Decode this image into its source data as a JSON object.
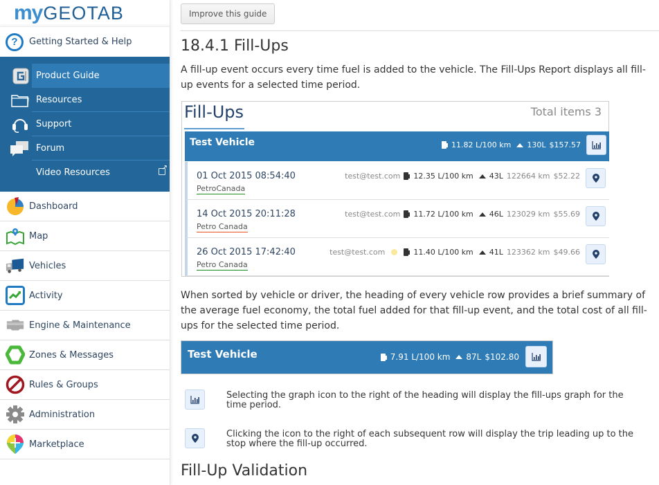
{
  "sidebar": {
    "logo": {
      "my": "my",
      "geotab": "GEOTAB"
    },
    "help": {
      "label": "Getting Started & Help",
      "icon": "question-circle-icon"
    },
    "help_items": [
      {
        "label": "Product Guide",
        "icon": "product-guide-icon",
        "active": true
      },
      {
        "label": "Resources",
        "icon": "folder-icon"
      },
      {
        "label": "Support",
        "icon": "headset-icon"
      },
      {
        "label": "Forum",
        "icon": "chat-bubbles-icon"
      },
      {
        "label": "Video Resources",
        "icon": "external-link-icon"
      }
    ],
    "nav_items": [
      {
        "label": "Dashboard",
        "icon": "pie-chart-icon"
      },
      {
        "label": "Map",
        "icon": "map-icon"
      },
      {
        "label": "Vehicles",
        "icon": "truck-icon"
      },
      {
        "label": "Activity",
        "icon": "activity-chart-icon"
      },
      {
        "label": "Engine & Maintenance",
        "icon": "engine-icon"
      },
      {
        "label": "Zones & Messages",
        "icon": "zone-icon"
      },
      {
        "label": "Rules & Groups",
        "icon": "prohibited-icon"
      },
      {
        "label": "Administration",
        "icon": "gear-icon"
      },
      {
        "label": "Marketplace",
        "icon": "marketplace-pin-icon"
      }
    ]
  },
  "main": {
    "improve_button": "Improve this guide",
    "title": "18.4.1 Fill-Ups",
    "intro": "A fill-up event occurs every time fuel is added to the vehicle. The Fill-Ups Report displays all fill-up events for a selected time period.",
    "widget": {
      "title": "Fill-Ups",
      "total": "Total items 3",
      "vehicle": {
        "name": "Test Vehicle",
        "economy": "11.82 L/100 km",
        "fuel": "130L",
        "cost": "$157.57"
      },
      "rows": [
        {
          "date": "01 Oct 2015 08:54:40",
          "station": "PetroCanada",
          "station_underline": "#1a8a1a",
          "user": "test@test.com",
          "sun": false,
          "economy": "12.35 L/100 km",
          "fuel": "43L",
          "odometer": "122664 km",
          "cost": "$52.22"
        },
        {
          "date": "14 Oct 2015 20:11:28",
          "station": "Petro Canada",
          "station_underline": "#e8521f",
          "user": "test@test.com",
          "sun": false,
          "economy": "11.72 L/100 km",
          "fuel": "46L",
          "odometer": "123029 km",
          "cost": "$55.69"
        },
        {
          "date": "26 Oct 2015 17:42:40",
          "station": "Petro Canada",
          "station_underline": "#1a8a1a",
          "user": "test@test.com",
          "sun": true,
          "economy": "11.40 L/100 km",
          "fuel": "41L",
          "odometer": "123362 km",
          "cost": "$49.66"
        }
      ]
    },
    "summary_text": "When sorted by vehicle or driver, the heading of every vehicle row provides a brief summary of the average fuel economy, the total fuel added for that fill-up event, and the total cost of all fill-ups for the selected time period.",
    "example_bar": {
      "name": "Test Vehicle",
      "economy": "7.91 L/100 km",
      "fuel": "87L",
      "cost": "$102.80"
    },
    "legend": [
      {
        "icon": "bar-chart-icon",
        "text": "Selecting the graph icon to the right of the heading will display the fill-ups graph for the time period."
      },
      {
        "icon": "map-pin-icon",
        "text": "Clicking the icon to the right of each subsequent row will display the trip leading up to the stop where the fill-up occurred."
      }
    ],
    "subheading": "Fill-Up Validation"
  },
  "colors": {
    "sidebar_help_bg": "#23679a",
    "sidebar_active": "#2f7bb6",
    "vehicle_bar": "#2e7bb5",
    "icon_button_bg": "#e8f1fb",
    "text_dark_blue": "#2e4560"
  }
}
